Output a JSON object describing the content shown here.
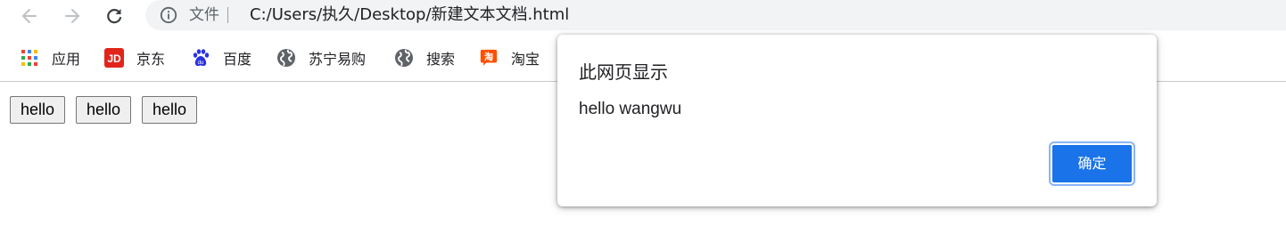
{
  "address_bar": {
    "scheme_label": "文件",
    "url": "C:/Users/执久/Desktop/新建文本文档.html"
  },
  "bookmarks": [
    {
      "label": "应用",
      "icon": "apps-grid-icon"
    },
    {
      "label": "京东",
      "icon": "jd-logo-icon",
      "color": "#e1251b"
    },
    {
      "label": "百度",
      "icon": "baidu-paw-icon",
      "color": "#2932e1"
    },
    {
      "label": "苏宁易购",
      "icon": "globe-icon"
    },
    {
      "label": "搜索",
      "icon": "globe-icon"
    },
    {
      "label": "淘宝",
      "icon": "taobao-logo-icon",
      "color": "#ff5000"
    }
  ],
  "page": {
    "buttons": [
      "hello",
      "hello",
      "hello"
    ]
  },
  "dialog": {
    "title": "此网页显示",
    "message": "hello wangwu",
    "ok_label": "确定",
    "accent": "#1a73e8"
  }
}
